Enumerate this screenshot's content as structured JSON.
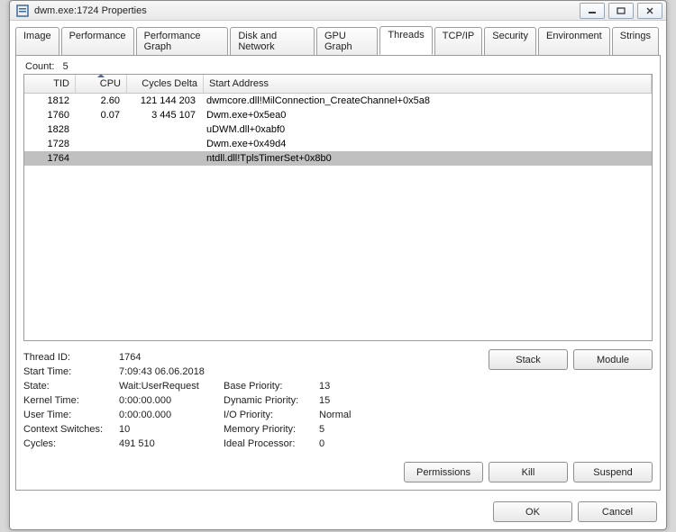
{
  "window": {
    "title": "dwm.exe:1724 Properties"
  },
  "tabs": [
    {
      "label": "Image"
    },
    {
      "label": "Performance"
    },
    {
      "label": "Performance Graph"
    },
    {
      "label": "Disk and Network"
    },
    {
      "label": "GPU Graph"
    },
    {
      "label": "Threads"
    },
    {
      "label": "TCP/IP"
    },
    {
      "label": "Security"
    },
    {
      "label": "Environment"
    },
    {
      "label": "Strings"
    }
  ],
  "active_tab_index": 5,
  "count_label": "Count:",
  "count_value": "5",
  "columns": {
    "tid": "TID",
    "cpu": "CPU",
    "cycles": "Cycles Delta",
    "start": "Start Address"
  },
  "rows": [
    {
      "tid": "1812",
      "cpu": "2.60",
      "cycles": "121 144 203",
      "addr": "dwmcore.dll!MilConnection_CreateChannel+0x5a8"
    },
    {
      "tid": "1760",
      "cpu": "0.07",
      "cycles": "3 445 107",
      "addr": "Dwm.exe+0x5ea0"
    },
    {
      "tid": "1828",
      "cpu": "",
      "cycles": "",
      "addr": "uDWM.dll+0xabf0"
    },
    {
      "tid": "1728",
      "cpu": "",
      "cycles": "",
      "addr": "Dwm.exe+0x49d4"
    },
    {
      "tid": "1764",
      "cpu": "",
      "cycles": "",
      "addr": "ntdll.dll!TplsTimerSet+0x8b0",
      "selected": true
    }
  ],
  "details": {
    "thread_id_label": "Thread ID:",
    "thread_id": "1764",
    "start_time_label": "Start Time:",
    "start_time": "7:09:43   06.06.2018",
    "state_label": "State:",
    "state": "Wait:UserRequest",
    "kernel_time_label": "Kernel Time:",
    "kernel_time": "0:00:00.000",
    "user_time_label": "User Time:",
    "user_time": "0:00:00.000",
    "ctx_label": "Context Switches:",
    "ctx": "10",
    "cycles_label": "Cycles:",
    "cycles": "491 510",
    "base_prio_label": "Base Priority:",
    "base_prio": "13",
    "dyn_prio_label": "Dynamic Priority:",
    "dyn_prio": "15",
    "io_prio_label": "I/O Priority:",
    "io_prio": "Normal",
    "mem_prio_label": "Memory Priority:",
    "mem_prio": "5",
    "ideal_proc_label": "Ideal Processor:",
    "ideal_proc": "0"
  },
  "buttons": {
    "stack": "Stack",
    "module": "Module",
    "permissions": "Permissions",
    "kill": "Kill",
    "suspend": "Suspend",
    "ok": "OK",
    "cancel": "Cancel"
  }
}
